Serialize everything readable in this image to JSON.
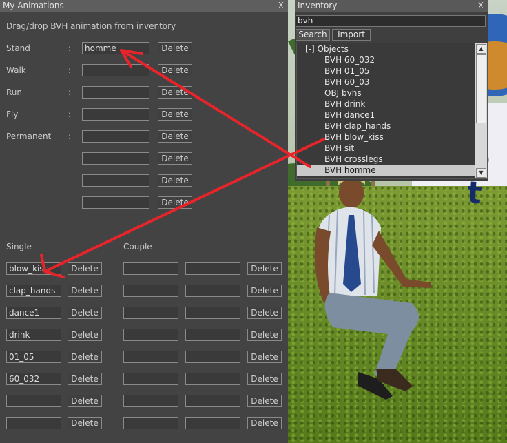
{
  "anim_panel": {
    "title": "My Animations",
    "close": "X",
    "instruction": "Drag/drop BVH animation from inventory",
    "colon": ":",
    "rows": [
      {
        "label": "Stand",
        "value": "homme"
      },
      {
        "label": "Walk",
        "value": ""
      },
      {
        "label": "Run",
        "value": ""
      },
      {
        "label": "Fly",
        "value": ""
      },
      {
        "label": "Permanent",
        "value": ""
      },
      {
        "label": "",
        "value": ""
      },
      {
        "label": "",
        "value": ""
      },
      {
        "label": "",
        "value": ""
      }
    ],
    "delete_label": "Delete",
    "single_header": "Single",
    "couple_header": "Couple",
    "single": [
      "blow_kiss",
      "clap_hands",
      "dance1",
      "drink",
      "01_05",
      "60_032",
      "",
      ""
    ],
    "couple": [
      [
        "",
        ""
      ],
      [
        "",
        ""
      ],
      [
        "",
        ""
      ],
      [
        "",
        ""
      ],
      [
        "",
        ""
      ],
      [
        "",
        ""
      ],
      [
        "",
        ""
      ],
      [
        "",
        ""
      ]
    ]
  },
  "inventory": {
    "title": "Inventory",
    "close": "X",
    "search_value": "bvh",
    "tabs": [
      "Search",
      "Import"
    ],
    "folder": "[-] Objects",
    "items": [
      {
        "label": "BVH 60_032",
        "selected": false
      },
      {
        "label": "BVH 01_05",
        "selected": false
      },
      {
        "label": "BVH 60_03",
        "selected": false
      },
      {
        "label": "OBJ bvhs",
        "selected": false
      },
      {
        "label": "BVH drink",
        "selected": false
      },
      {
        "label": "BVH dance1",
        "selected": false
      },
      {
        "label": "BVH clap_hands",
        "selected": false
      },
      {
        "label": "BVH blow_kiss",
        "selected": false
      },
      {
        "label": "BVH sit",
        "selected": false
      },
      {
        "label": "BVH crosslegs",
        "selected": false
      },
      {
        "label": "BVH homme",
        "selected": true
      },
      {
        "label": "BVH ...",
        "selected": false
      }
    ],
    "scroll_up_icon": "triangle-up",
    "scroll_down_icon": "triangle-down"
  },
  "scene": {
    "billboard_text": "e t",
    "annotation_color": "#e8242b"
  }
}
